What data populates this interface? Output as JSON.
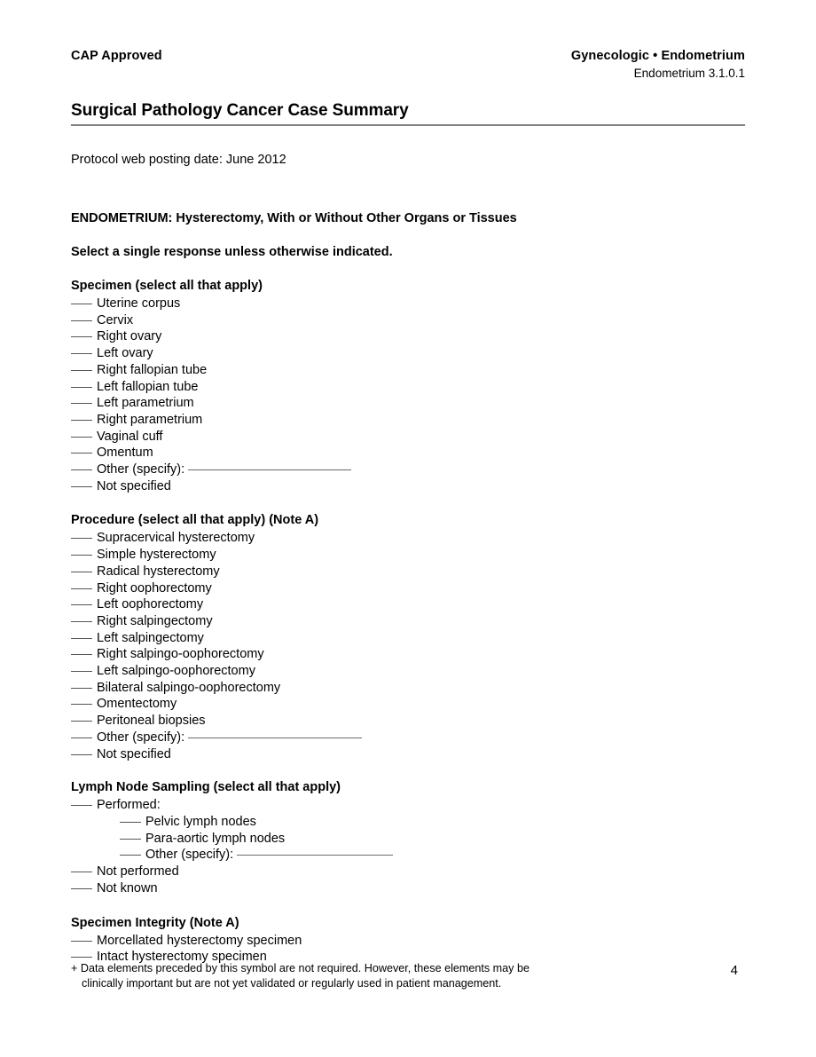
{
  "header": {
    "left_label": "CAP Approved",
    "org_line": "Gynecologic • Endometrium",
    "version_line": "Endometrium 3.1.0.1"
  },
  "title": "Surgical Pathology Cancer Case Summary",
  "posting_date": "Protocol web posting date: June 2012",
  "protocol_line": "ENDOMETRIUM: Hysterectomy, With or Without Other Organs or Tissues",
  "instruction_line": "Select a single response unless otherwise indicated.",
  "sections": [
    {
      "heading": "Specimen (select all that apply)",
      "items": [
        {
          "label": "Uterine corpus"
        },
        {
          "label": "Cervix"
        },
        {
          "label": "Right ovary"
        },
        {
          "label": "Left ovary"
        },
        {
          "label": "Right fallopian tube"
        },
        {
          "label": "Left fallopian tube"
        },
        {
          "label": "Left parametrium"
        },
        {
          "label": "Right parametrium"
        },
        {
          "label": "Vaginal cuff"
        },
        {
          "label": "Omentum"
        },
        {
          "label": "Other (specify):",
          "fill": true
        },
        {
          "label": "Not specified"
        }
      ]
    },
    {
      "heading": "Procedure (select all that apply) (Note A)",
      "items": [
        {
          "label": "Supracervical hysterectomy"
        },
        {
          "label": "Simple hysterectomy"
        },
        {
          "label": "Radical hysterectomy"
        },
        {
          "label": "Right oophorectomy"
        },
        {
          "label": "Left oophorectomy"
        },
        {
          "label": "Right salpingectomy"
        },
        {
          "label": "Left salpingectomy"
        },
        {
          "label": "Right salpingo-oophorectomy"
        },
        {
          "label": "Left salpingo-oophorectomy"
        },
        {
          "label": "Bilateral salpingo-oophorectomy"
        },
        {
          "label": "Omentectomy"
        },
        {
          "label": "Peritoneal biopsies"
        },
        {
          "label": "Other (specify):",
          "fill": true
        },
        {
          "label": "Not specified"
        }
      ]
    },
    {
      "heading": "Lymph Node Sampling (select all that apply)",
      "items": [
        {
          "label": "Performed:"
        },
        {
          "label": "Pelvic lymph nodes",
          "indent": true
        },
        {
          "label": "Para-aortic lymph nodes",
          "indent": true
        },
        {
          "label": "Other (specify):",
          "indent": true,
          "fill": true
        },
        {
          "label": "Not performed"
        },
        {
          "label": "Not known"
        }
      ]
    },
    {
      "heading": "Specimen Integrity (Note A)",
      "items": [
        {
          "label": "Morcellated hysterectomy specimen"
        },
        {
          "label": "Intact hysterectomy specimen"
        }
      ]
    }
  ],
  "footer": {
    "symbol": "+",
    "note_line1": "Data elements preceded by this symbol are not required. However, these elements may be",
    "note_line2": "clinically important but are not yet validated or regularly used in patient management.",
    "page_number": "4"
  }
}
